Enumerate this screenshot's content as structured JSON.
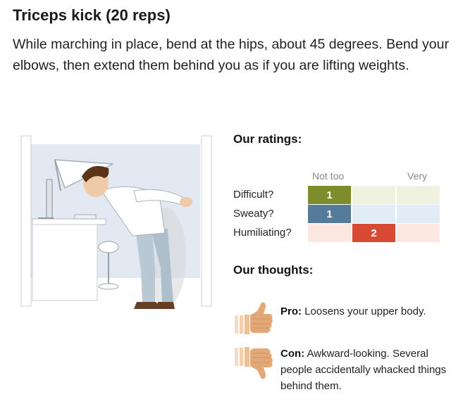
{
  "article": {
    "title": "Triceps kick (20 reps)",
    "description": "While marching in place, bend at the hips, about 45 degrees. Bend your elbows, then extend them behind you as if you are lifting weights."
  },
  "ratings": {
    "heading": "Our ratings:",
    "scale_low": "Not too",
    "scale_high": "Very",
    "rows": [
      {
        "label": "Difficult?",
        "value": 1,
        "color": "#7d8d2c",
        "tint": "#eef2de"
      },
      {
        "label": "Sweaty?",
        "value": 1,
        "color": "#557a9a",
        "tint": "#e2ecf6"
      },
      {
        "label": "Humiliating?",
        "value": 2,
        "color": "#d84a33",
        "tint": "#fde8e1"
      }
    ]
  },
  "thoughts": {
    "heading": "Our thoughts:",
    "pro_label": "Pro:",
    "pro_text": " Loosens your upper body.",
    "con_label": "Con:",
    "con_text": " Awkward-looking. Several people accidentally whacked things behind them."
  },
  "icons": {
    "pro": "thumbs-up-icon",
    "con": "thumbs-down-icon"
  }
}
